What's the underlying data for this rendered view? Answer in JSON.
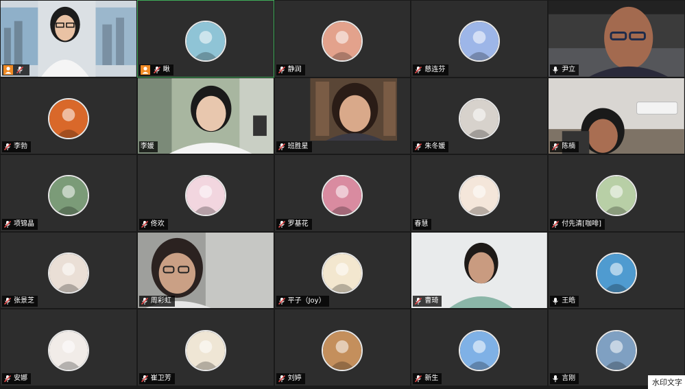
{
  "participants": [
    {
      "name": "",
      "kind": "video",
      "host": true,
      "scene": "office-window",
      "mic": "muted"
    },
    {
      "name": "瞅",
      "kind": "avatar",
      "host": true,
      "active": true,
      "avatar_color": "#8fc4d6",
      "mic": "muted"
    },
    {
      "name": "静润",
      "kind": "avatar",
      "avatar_color": "#e3a28c",
      "mic": "muted"
    },
    {
      "name": "慈连芬",
      "kind": "avatar",
      "avatar_color": "#9db6e8",
      "mic": "muted"
    },
    {
      "name": "尹立",
      "kind": "video",
      "scene": "man-glasses",
      "mic": "on"
    },
    {
      "name": "李勃",
      "kind": "avatar",
      "avatar_color": "#d9682a",
      "mic": "muted"
    },
    {
      "name": "李媛",
      "kind": "video",
      "scene": "woman-room",
      "mic": "none"
    },
    {
      "name": "班胜星",
      "kind": "video",
      "scene": "woman-bookshelf",
      "mic": "muted"
    },
    {
      "name": "朱冬媛",
      "kind": "avatar",
      "avatar_color": "#d7d2cc",
      "mic": "muted"
    },
    {
      "name": "陈楠",
      "kind": "video",
      "scene": "woman-ac",
      "mic": "muted"
    },
    {
      "name": "项锦晶",
      "kind": "avatar",
      "avatar_color": "#7b9b78",
      "mic": "muted"
    },
    {
      "name": "佟欢",
      "kind": "avatar",
      "avatar_color": "#f2d6df",
      "mic": "muted"
    },
    {
      "name": "罗基花",
      "kind": "avatar",
      "avatar_color": "#d98ba0",
      "mic": "muted"
    },
    {
      "name": "春慧",
      "kind": "avatar",
      "avatar_color": "#f4e6da",
      "mic": "none"
    },
    {
      "name": "付先清[咖啡]",
      "kind": "avatar",
      "avatar_color": "#b8cfa6",
      "mic": "muted"
    },
    {
      "name": "张景芝",
      "kind": "avatar",
      "avatar_color": "#eadfd6",
      "mic": "muted"
    },
    {
      "name": "周彩虹",
      "kind": "video",
      "scene": "girl-glasses",
      "mic": "muted"
    },
    {
      "name": "平子（Joy）",
      "kind": "avatar",
      "avatar_color": "#f3e7cf",
      "mic": "muted"
    },
    {
      "name": "曹琦",
      "kind": "video",
      "scene": "woman-white-wall",
      "mic": "muted"
    },
    {
      "name": "王皓",
      "kind": "avatar",
      "avatar_color": "#4f9bd0",
      "mic": "on"
    },
    {
      "name": "安娜",
      "kind": "avatar",
      "avatar_color": "#f1ece8",
      "mic": "muted"
    },
    {
      "name": "崔卫芳",
      "kind": "avatar",
      "avatar_color": "#efe6d5",
      "mic": "muted"
    },
    {
      "name": "刘婷",
      "kind": "avatar",
      "avatar_color": "#c48f5c",
      "mic": "muted"
    },
    {
      "name": "新生",
      "kind": "avatar",
      "avatar_color": "#7fb1e6",
      "mic": "muted"
    },
    {
      "name": "言刚",
      "kind": "avatar",
      "avatar_color": "#7fa0c2",
      "mic": "on"
    }
  ],
  "watermark": "水印文字",
  "colors": {
    "tile_bg": "#2d2d2d",
    "active_border": "#3fae5a",
    "host_badge": "#f08a24",
    "muted_mic": "#e24b4b"
  }
}
